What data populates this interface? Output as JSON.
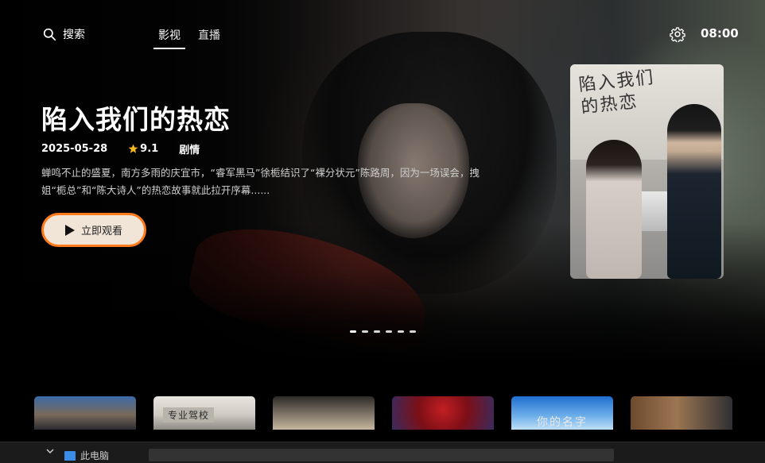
{
  "header": {
    "search_label": "搜索",
    "tabs": [
      {
        "label": "影视",
        "active": true
      },
      {
        "label": "直播",
        "active": false
      }
    ],
    "time": "08:00"
  },
  "featured": {
    "title": "陷入我们的热恋",
    "date": "2025-05-28",
    "rating": "9.1",
    "genre": "剧情",
    "description": "蝉鸣不止的盛夏，南方多雨的庆宜市，“睿军黑马”徐栀结识了“裸分状元”陈路周，因为一场误会，拽姐“栀总”和“陈大诗人”的热恋故事就此拉开序幕......",
    "watch_label": "立即观看",
    "poster_title": "陷入我们的热恋",
    "carousel_count": 6,
    "carousel_active": 0
  },
  "thumbnails": [
    {
      "caption": ""
    },
    {
      "caption": "专业驾校"
    },
    {
      "caption": ""
    },
    {
      "caption": ""
    },
    {
      "caption": "你的名字"
    },
    {
      "caption": ""
    }
  ],
  "taskbar": {
    "item_label": "此电脑"
  },
  "colors": {
    "accent": "#ff7a1a",
    "button_bg": "#f1e5d8",
    "star": "#f5b81c"
  }
}
